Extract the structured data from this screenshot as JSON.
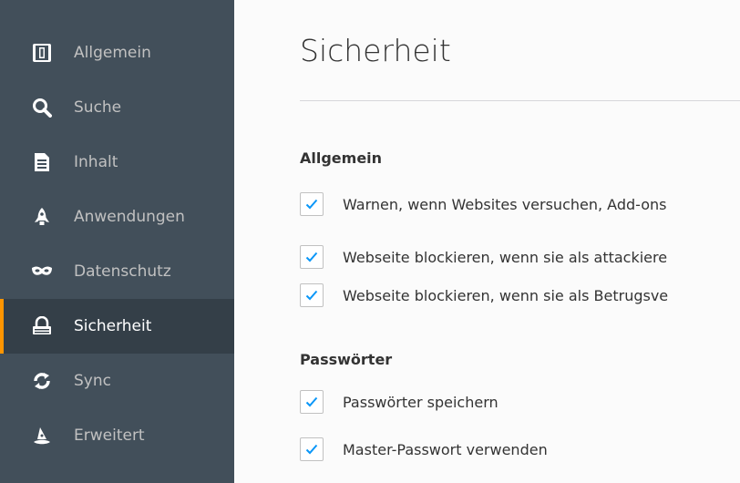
{
  "sidebar": {
    "items": [
      {
        "label": "Allgemein",
        "icon": "general-icon",
        "selected": false
      },
      {
        "label": "Suche",
        "icon": "search-icon",
        "selected": false
      },
      {
        "label": "Inhalt",
        "icon": "document-icon",
        "selected": false
      },
      {
        "label": "Anwendungen",
        "icon": "rocket-icon",
        "selected": false
      },
      {
        "label": "Datenschutz",
        "icon": "mask-icon",
        "selected": false
      },
      {
        "label": "Sicherheit",
        "icon": "lock-icon",
        "selected": true
      },
      {
        "label": "Sync",
        "icon": "sync-icon",
        "selected": false
      },
      {
        "label": "Erweitert",
        "icon": "wizard-hat-icon",
        "selected": false
      }
    ]
  },
  "main": {
    "title": "Sicherheit",
    "sections": [
      {
        "heading": "Allgemein",
        "checkboxes": [
          {
            "label": "Warnen, wenn Websites versuchen, Add-ons",
            "checked": true
          },
          {
            "label": "Webseite blockieren, wenn sie als attackiere",
            "checked": true
          },
          {
            "label": "Webseite blockieren, wenn sie als Betrugsve",
            "checked": true
          }
        ]
      },
      {
        "heading": "Passwörter",
        "checkboxes": [
          {
            "label": "Passwörter speichern",
            "checked": true
          },
          {
            "label": "Master-Passwort verwenden",
            "checked": true
          }
        ]
      }
    ]
  },
  "colors": {
    "sidebar_bg": "#424f5a",
    "sidebar_selected_bg": "#343f48",
    "accent_orange": "#ff9500",
    "checkmark_blue": "#0996f8"
  }
}
